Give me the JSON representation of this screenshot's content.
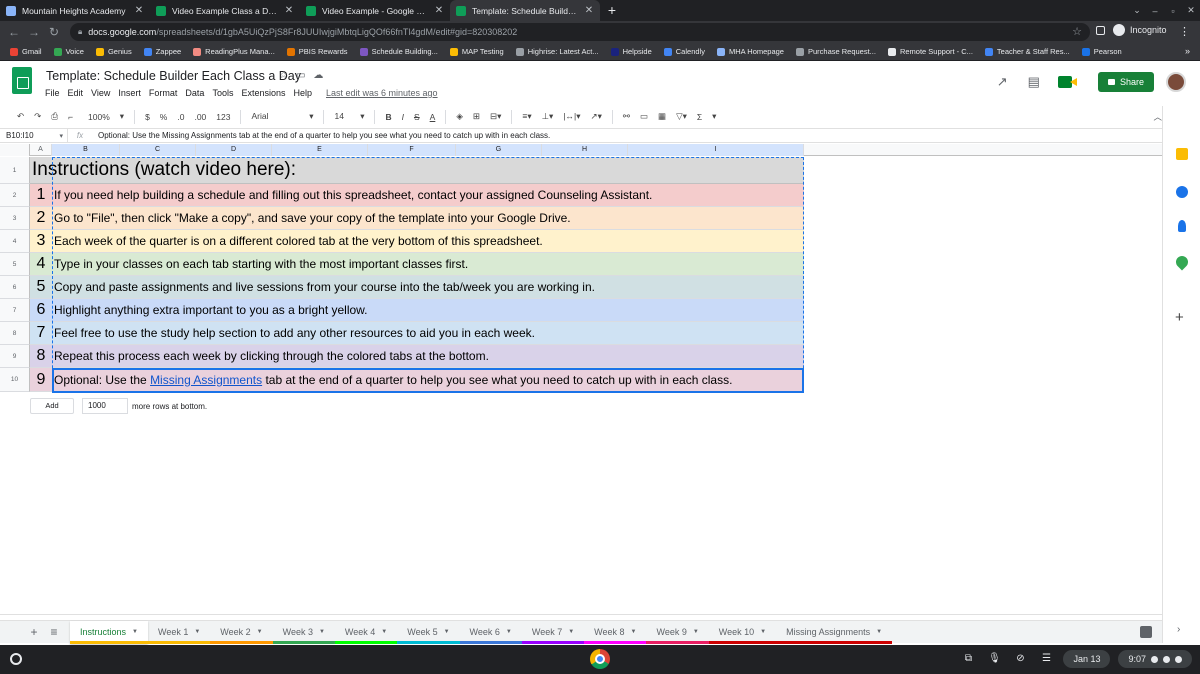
{
  "browser": {
    "tabs": [
      {
        "title": "Mountain Heights Academy",
        "favicon_color": "#8ab4f8",
        "active": false
      },
      {
        "title": "Video Example Class a Day - Go",
        "favicon_color": "#0f9d58",
        "active": false
      },
      {
        "title": "Video Example - Google Sheets",
        "favicon_color": "#0f9d58",
        "active": false
      },
      {
        "title": "Template: Schedule Builder Eac",
        "favicon_color": "#0f9d58",
        "active": true
      }
    ],
    "close_glyph": "✕",
    "new_tab_glyph": "+",
    "url_host": "docs.google.com",
    "url_path": "/spreadsheets/d/1gbA5UiQzPjS8Fr8JUUIwjgiMbtqLigQOf66fnTl4gdM/edit#gid=820308202",
    "incognito_label": "Incognito",
    "bookmarks": [
      {
        "label": "Gmail",
        "color": "#ea4335"
      },
      {
        "label": "Voice",
        "color": "#34a853"
      },
      {
        "label": "Genius",
        "color": "#fbbc04"
      },
      {
        "label": "Zappee",
        "color": "#4285f4"
      },
      {
        "label": "ReadingPlus Mana...",
        "color": "#f28b82"
      },
      {
        "label": "PBIS Rewards",
        "color": "#e37400"
      },
      {
        "label": "Schedule Building...",
        "color": "#7e57c2"
      },
      {
        "label": "MAP Testing",
        "color": "#fbbc04"
      },
      {
        "label": "Highrise: Latest Act...",
        "color": "#9aa0a6"
      },
      {
        "label": "Helpside",
        "color": "#1a237e"
      },
      {
        "label": "Calendly",
        "color": "#4285f4"
      },
      {
        "label": "MHA Homepage",
        "color": "#8ab4f8"
      },
      {
        "label": "Purchase Request...",
        "color": "#9aa0a6"
      },
      {
        "label": "Remote Support - C...",
        "color": "#e8eaed"
      },
      {
        "label": "Teacher & Staff Res...",
        "color": "#4285f4"
      },
      {
        "label": "Pearson",
        "color": "#1a73e8"
      }
    ],
    "bookmarks_more": "»"
  },
  "sheets": {
    "doc_title": "Template: Schedule Builder Each Class a Day",
    "menu": [
      "File",
      "Edit",
      "View",
      "Insert",
      "Format",
      "Data",
      "Tools",
      "Extensions",
      "Help"
    ],
    "last_edit": "Last edit was 6 minutes ago",
    "share_label": "Share",
    "accent": "#188038"
  },
  "toolbar": {
    "zoom": "100%",
    "currency": "$",
    "percent": "%",
    "dec_decrease": ".0",
    "dec_increase": ".00",
    "format_123": "123",
    "font": "Arial",
    "font_size": "14",
    "bold": "B",
    "italic": "I",
    "strike": "S",
    "text_color": "A",
    "sigma": "Σ"
  },
  "formula_bar": {
    "name_box": "B10:I10",
    "fx": "fx",
    "content": "Optional: Use the Missing Assignments tab at the end of a quarter to help you see what you need to catch up with in each class."
  },
  "columns": [
    "A",
    "B",
    "C",
    "D",
    "E",
    "F",
    "G",
    "H",
    "I"
  ],
  "row_numbers": [
    "1",
    "2",
    "3",
    "4",
    "5",
    "6",
    "7",
    "8",
    "9",
    "10"
  ],
  "instructions": {
    "heading": "Instructions (watch video here):",
    "steps": [
      {
        "num": "1",
        "text": "If you need help building a schedule and filling out this spreadsheet, contact your assigned Counseling Assistant.",
        "color": "#f4cccc"
      },
      {
        "num": "2",
        "text": "Go to \"File\", then click \"Make a copy\", and save your copy of the template into your Google Drive.",
        "color": "#fce5cd"
      },
      {
        "num": "3",
        "text": "Each week of the quarter is on a different colored tab at the very bottom of this spreadsheet.",
        "color": "#fff2cc"
      },
      {
        "num": "4",
        "text": "Type in your classes on each tab starting with the most important classes first.",
        "color": "#d9ead3"
      },
      {
        "num": "5",
        "text": "Copy and paste assignments and live sessions from your course into the tab/week you are working in.",
        "color": "#d0e0e3"
      },
      {
        "num": "6",
        "text": "Highlight anything extra important to you as a bright yellow.",
        "color": "#c9daf8"
      },
      {
        "num": "7",
        "text": "Feel free to use the study help section to add any other resources to aid you in each week.",
        "color": "#cfe2f3"
      },
      {
        "num": "8",
        "text": "Repeat this process each week by clicking through the colored tabs at the bottom.",
        "color": "#d9d2e9"
      }
    ],
    "last_step": {
      "num": "9",
      "prefix": "Optional: Use the ",
      "link": "Missing Assignments",
      "suffix": " tab at the end of a quarter to help you see what you need to catch up with in each class.",
      "color": "#ead1dc"
    }
  },
  "add_rows": {
    "button": "Add",
    "count": "1000",
    "suffix": "more rows at bottom."
  },
  "sheet_tabs": [
    {
      "label": "Instructions",
      "color": "#fbbc04",
      "active": true
    },
    {
      "label": "Week 1",
      "color": "#fbbc04",
      "active": false
    },
    {
      "label": "Week 2",
      "color": "#ff9900",
      "active": false
    },
    {
      "label": "Week 3",
      "color": "#34a853",
      "active": false
    },
    {
      "label": "Week 4",
      "color": "#00ff00",
      "active": false
    },
    {
      "label": "Week 5",
      "color": "#00bcd4",
      "active": false
    },
    {
      "label": "Week 6",
      "color": "#3c78d8",
      "active": false
    },
    {
      "label": "Week 7",
      "color": "#9900ff",
      "active": false
    },
    {
      "label": "Week 8",
      "color": "#ff00ff",
      "active": false
    },
    {
      "label": "Week 9",
      "color": "#e91e63",
      "active": false
    },
    {
      "label": "Week 10",
      "color": "#cc0000",
      "active": false
    },
    {
      "label": "Missing Assignments",
      "color": "#cc0000",
      "active": false
    }
  ],
  "shelf": {
    "date": "Jan 13",
    "time": "9:07"
  }
}
